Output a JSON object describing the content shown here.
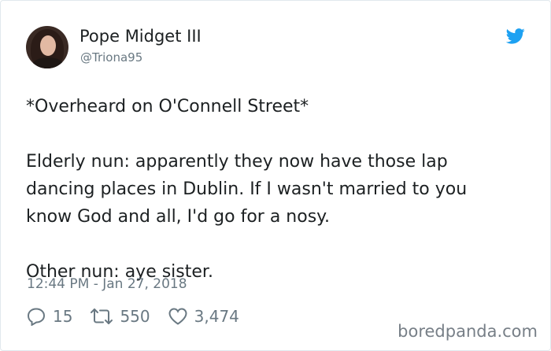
{
  "author": {
    "display_name": "Pope Midget III",
    "handle": "@Triona95"
  },
  "tweet": {
    "lines": [
      "*Overheard on O'Connell Street*",
      "Elderly nun: apparently they now have those lap",
      "dancing places in Dublin. If I wasn't married to you",
      "know God and all, I'd go for a nosy.",
      "Other nun: aye sister."
    ],
    "timestamp": "12:44 PM - Jan 27, 2018"
  },
  "actions": {
    "replies": "15",
    "retweets": "550",
    "likes": "3,474"
  },
  "watermark": "boredpanda.com",
  "colors": {
    "twitter_blue": "#1da1f2",
    "muted": "#697882",
    "text": "#1c2022"
  },
  "icons": [
    "avatar",
    "twitter-bird-icon",
    "reply-icon",
    "retweet-icon",
    "heart-icon"
  ]
}
